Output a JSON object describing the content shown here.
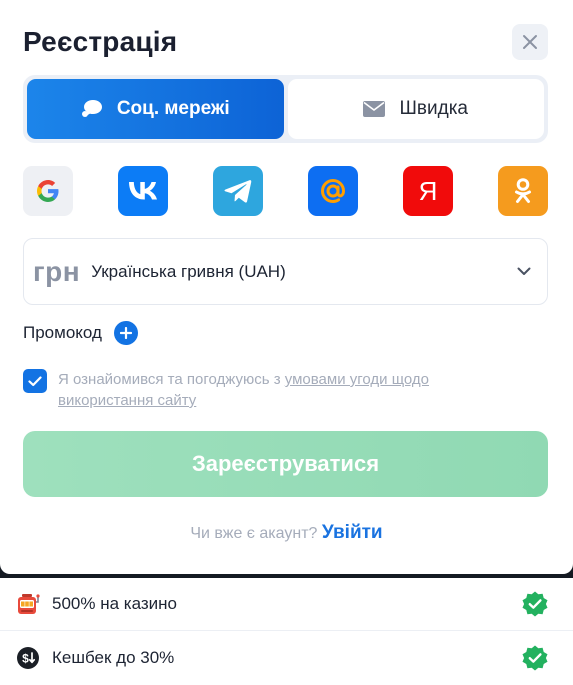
{
  "modal": {
    "title": "Реєстрація"
  },
  "tabs": [
    {
      "label": "Соц. мережі",
      "icon": "chat-bubble-icon",
      "active": true
    },
    {
      "label": "Швидка",
      "icon": "envelope-icon",
      "active": false
    }
  ],
  "socials": [
    {
      "name": "google",
      "letter": "G"
    },
    {
      "name": "vk",
      "letter": "VK"
    },
    {
      "name": "telegram"
    },
    {
      "name": "mail",
      "letter": "@"
    },
    {
      "name": "yandex",
      "letter": "Я"
    },
    {
      "name": "odnoklassniki"
    }
  ],
  "currency": {
    "symbol": "грн",
    "name": "Українська гривня (UAH)"
  },
  "promo": {
    "label": "Промокод"
  },
  "agreement": {
    "checked": true,
    "text": "Я ознайомився та погоджуюсь з",
    "link": "умовами угоди щодо використання сайту"
  },
  "submit": {
    "label": "Зареєструватися"
  },
  "login": {
    "question": "Чи вже є акаунт?",
    "link": "Увійти"
  },
  "bonuses": [
    {
      "icon": "slot-machine-icon",
      "text": "500% на казино",
      "status": "check-badge-icon"
    },
    {
      "icon": "cashback-icon",
      "text": "Кешбек до 30%",
      "status": "check-badge-icon"
    }
  ],
  "colors": {
    "accent": "#1373e3",
    "submit": "#9ee0bd",
    "success": "#23b15f"
  }
}
